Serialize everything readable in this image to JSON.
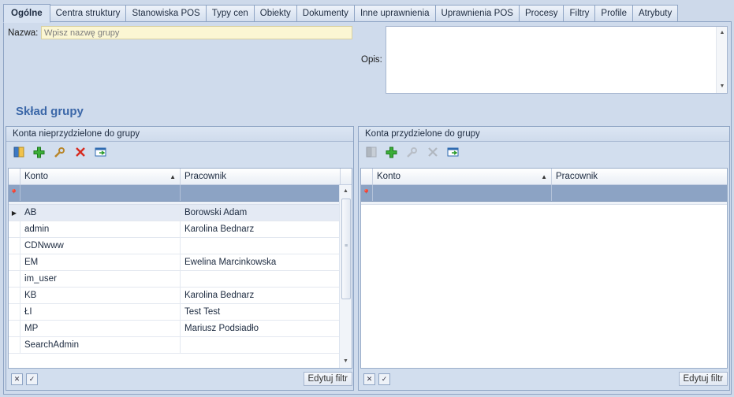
{
  "tabs": [
    "Ogólne",
    "Centra struktury",
    "Stanowiska POS",
    "Typy cen",
    "Obiekty",
    "Dokumenty",
    "Inne uprawnienia",
    "Uprawnienia POS",
    "Procesy",
    "Filtry",
    "Profile",
    "Atrybuty"
  ],
  "form": {
    "name_label": "Nazwa:",
    "name_placeholder": "Wpisz nazwę grupy",
    "opis_label": "Opis:"
  },
  "section_title": "Skład grupy",
  "left_panel": {
    "title": "Konta nieprzydzielone do grupy",
    "columns": [
      "Konto",
      "Pracownik"
    ],
    "rows": [
      {
        "konto": "AB",
        "pracownik": "Borowski Adam"
      },
      {
        "konto": "admin",
        "pracownik": "Karolina Bednarz"
      },
      {
        "konto": "CDNwww",
        "pracownik": ""
      },
      {
        "konto": "EM",
        "pracownik": "Ewelina Marcinkowska"
      },
      {
        "konto": "im_user",
        "pracownik": ""
      },
      {
        "konto": "KB",
        "pracownik": "Karolina Bednarz"
      },
      {
        "konto": "ŁI",
        "pracownik": "Test Test"
      },
      {
        "konto": "MP",
        "pracownik": "Mariusz Podsiadło"
      },
      {
        "konto": "SearchAdmin",
        "pracownik": ""
      }
    ],
    "edit_filter": "Edytuj filtr"
  },
  "right_panel": {
    "title": "Konta przydzielone do grupy",
    "columns": [
      "Konto",
      "Pracownik"
    ],
    "edit_filter": "Edytuj filtr"
  },
  "colors": {
    "accent": "#3b67a8",
    "filter_row": "#8ca3c4",
    "name_input_bg": "#fbf6d3",
    "background": "#cdd9ea"
  }
}
